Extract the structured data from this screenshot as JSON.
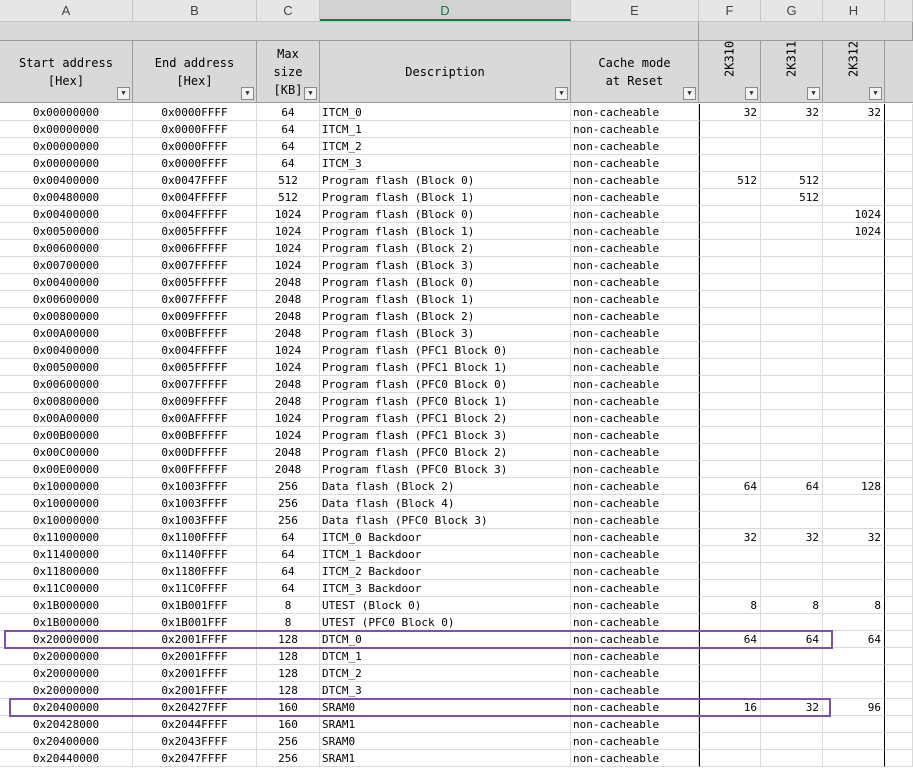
{
  "columns": [
    "A",
    "B",
    "C",
    "D",
    "E",
    "F",
    "G",
    "H"
  ],
  "active_column": "D",
  "headers": {
    "start": "Start address\n[Hex]",
    "end": "End address\n[Hex]",
    "size": "Max\nsize\n[KB]",
    "desc": "Description",
    "cache": "Cache mode\nat Reset",
    "k310": "2K310",
    "k311": "2K311",
    "k312": "2K312"
  },
  "filter_icon": "dropdown-arrow-icon",
  "highlight_color": "#7b52a8",
  "rows": [
    [
      "0x00000000",
      "0x0000FFFF",
      "64",
      "ITCM_0",
      "non-cacheable",
      "32",
      "32",
      "32"
    ],
    [
      "0x00000000",
      "0x0000FFFF",
      "64",
      "ITCM_1",
      "non-cacheable",
      "",
      "",
      ""
    ],
    [
      "0x00000000",
      "0x0000FFFF",
      "64",
      "ITCM_2",
      "non-cacheable",
      "",
      "",
      ""
    ],
    [
      "0x00000000",
      "0x0000FFFF",
      "64",
      "ITCM_3",
      "non-cacheable",
      "",
      "",
      ""
    ],
    [
      "0x00400000",
      "0x0047FFFF",
      "512",
      "Program flash (Block 0)",
      "non-cacheable",
      "512",
      "512",
      ""
    ],
    [
      "0x00480000",
      "0x004FFFFF",
      "512",
      "Program flash (Block 1)",
      "non-cacheable",
      "",
      "512",
      ""
    ],
    [
      "0x00400000",
      "0x004FFFFF",
      "1024",
      "Program flash (Block 0)",
      "non-cacheable",
      "",
      "",
      "1024"
    ],
    [
      "0x00500000",
      "0x005FFFFF",
      "1024",
      "Program flash (Block 1)",
      "non-cacheable",
      "",
      "",
      "1024"
    ],
    [
      "0x00600000",
      "0x006FFFFF",
      "1024",
      "Program flash (Block 2)",
      "non-cacheable",
      "",
      "",
      ""
    ],
    [
      "0x00700000",
      "0x007FFFFF",
      "1024",
      "Program flash (Block 3)",
      "non-cacheable",
      "",
      "",
      ""
    ],
    [
      "0x00400000",
      "0x005FFFFF",
      "2048",
      "Program flash (Block 0)",
      "non-cacheable",
      "",
      "",
      ""
    ],
    [
      "0x00600000",
      "0x007FFFFF",
      "2048",
      "Program flash (Block 1)",
      "non-cacheable",
      "",
      "",
      ""
    ],
    [
      "0x00800000",
      "0x009FFFFF",
      "2048",
      "Program flash (Block 2)",
      "non-cacheable",
      "",
      "",
      ""
    ],
    [
      "0x00A00000",
      "0x00BFFFFF",
      "2048",
      "Program flash (Block 3)",
      "non-cacheable",
      "",
      "",
      ""
    ],
    [
      "0x00400000",
      "0x004FFFFF",
      "1024",
      "Program flash (PFC1 Block 0)",
      "non-cacheable",
      "",
      "",
      ""
    ],
    [
      "0x00500000",
      "0x005FFFFF",
      "1024",
      "Program flash (PFC1 Block 1)",
      "non-cacheable",
      "",
      "",
      ""
    ],
    [
      "0x00600000",
      "0x007FFFFF",
      "2048",
      "Program flash (PFC0 Block 0)",
      "non-cacheable",
      "",
      "",
      ""
    ],
    [
      "0x00800000",
      "0x009FFFFF",
      "2048",
      "Program flash (PFC0 Block 1)",
      "non-cacheable",
      "",
      "",
      ""
    ],
    [
      "0x00A00000",
      "0x00AFFFFF",
      "1024",
      "Program flash (PFC1 Block 2)",
      "non-cacheable",
      "",
      "",
      ""
    ],
    [
      "0x00B00000",
      "0x00BFFFFF",
      "1024",
      "Program flash (PFC1 Block 3)",
      "non-cacheable",
      "",
      "",
      ""
    ],
    [
      "0x00C00000",
      "0x00DFFFFF",
      "2048",
      "Program flash (PFC0 Block 2)",
      "non-cacheable",
      "",
      "",
      ""
    ],
    [
      "0x00E00000",
      "0x00FFFFFF",
      "2048",
      "Program flash (PFC0 Block 3)",
      "non-cacheable",
      "",
      "",
      ""
    ],
    [
      "0x10000000",
      "0x1003FFFF",
      "256",
      "Data flash (Block 2)",
      "non-cacheable",
      "64",
      "64",
      "128"
    ],
    [
      "0x10000000",
      "0x1003FFFF",
      "256",
      "Data flash (Block 4)",
      "non-cacheable",
      "",
      "",
      ""
    ],
    [
      "0x10000000",
      "0x1003FFFF",
      "256",
      "Data flash (PFC0 Block 3)",
      "non-cacheable",
      "",
      "",
      ""
    ],
    [
      "0x11000000",
      "0x1100FFFF",
      "64",
      "ITCM_0 Backdoor",
      "non-cacheable",
      "32",
      "32",
      "32"
    ],
    [
      "0x11400000",
      "0x1140FFFF",
      "64",
      "ITCM_1 Backdoor",
      "non-cacheable",
      "",
      "",
      ""
    ],
    [
      "0x11800000",
      "0x1180FFFF",
      "64",
      "ITCM_2 Backdoor",
      "non-cacheable",
      "",
      "",
      ""
    ],
    [
      "0x11C00000",
      "0x11C0FFFF",
      "64",
      "ITCM_3 Backdoor",
      "non-cacheable",
      "",
      "",
      ""
    ],
    [
      "0x1B000000",
      "0x1B001FFF",
      "8",
      "UTEST (Block 0)",
      "non-cacheable",
      "8",
      "8",
      "8"
    ],
    [
      "0x1B000000",
      "0x1B001FFF",
      "8",
      "UTEST (PFC0 Block 0)",
      "non-cacheable",
      "",
      "",
      ""
    ],
    [
      "0x20000000",
      "0x2001FFFF",
      "128",
      "DTCM_0",
      "non-cacheable",
      "64",
      "64",
      "64"
    ],
    [
      "0x20000000",
      "0x2001FFFF",
      "128",
      "DTCM_1",
      "non-cacheable",
      "",
      "",
      ""
    ],
    [
      "0x20000000",
      "0x2001FFFF",
      "128",
      "DTCM_2",
      "non-cacheable",
      "",
      "",
      ""
    ],
    [
      "0x20000000",
      "0x2001FFFF",
      "128",
      "DTCM_3",
      "non-cacheable",
      "",
      "",
      ""
    ],
    [
      "0x20400000",
      "0x20427FFF",
      "160",
      "SRAM0",
      "non-cacheable",
      "16",
      "32",
      "96"
    ],
    [
      "0x20428000",
      "0x2044FFFF",
      "160",
      "SRAM1",
      "non-cacheable",
      "",
      "",
      ""
    ],
    [
      "0x20400000",
      "0x2043FFFF",
      "256",
      "SRAM0",
      "non-cacheable",
      "",
      "",
      ""
    ],
    [
      "0x20440000",
      "0x2047FFFF",
      "256",
      "SRAM1",
      "non-cacheable",
      "",
      "",
      ""
    ]
  ]
}
